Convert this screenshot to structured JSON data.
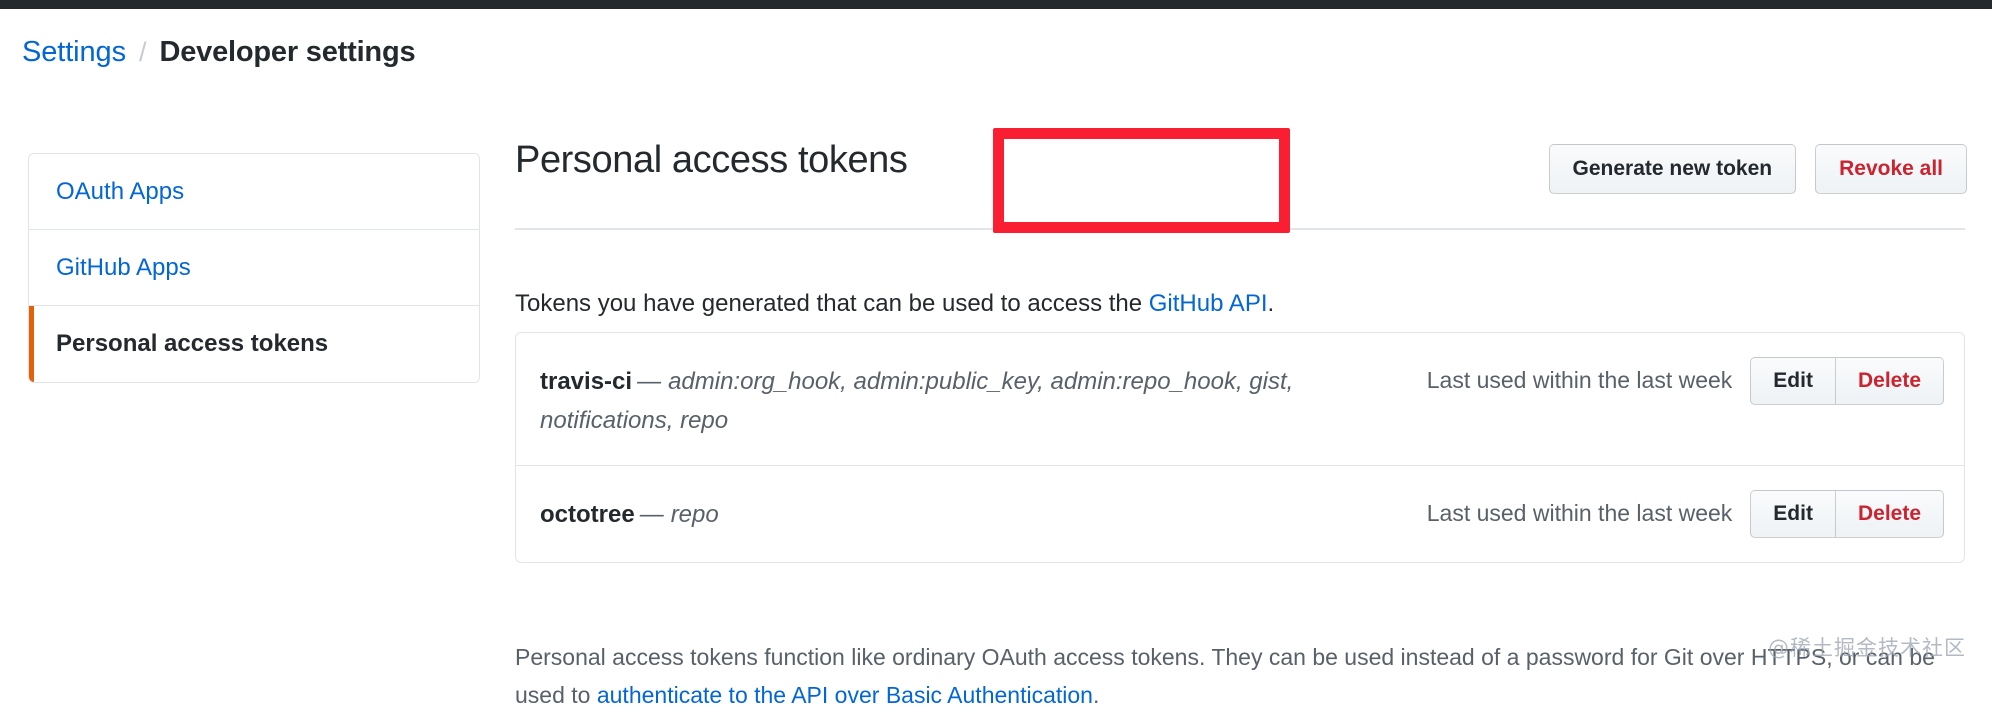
{
  "window": {
    "title": "Personal access tokens"
  },
  "topbar": {
    "color": "#24292e"
  },
  "breadcrumb": {
    "parent": "Settings",
    "separator": "/",
    "current": "Developer settings"
  },
  "sidebar": {
    "items": [
      {
        "label": "OAuth Apps",
        "active": false
      },
      {
        "label": "GitHub Apps",
        "active": false
      },
      {
        "label": "Personal access tokens",
        "active": true
      }
    ],
    "active_indicator_color": "#e36209"
  },
  "main": {
    "title": "Personal access tokens",
    "actions": {
      "generate_label": "Generate new token",
      "revoke_label": "Revoke all"
    },
    "intro": {
      "before_link": "Tokens you have generated that can be used to access the ",
      "link_text": "GitHub API",
      "after_link": "."
    },
    "tokens": [
      {
        "name": "travis-ci",
        "dash": "—",
        "scopes": "admin:org_hook, admin:public_key, admin:repo_hook, gist, notifications, repo",
        "last_used": "Last used within the last week",
        "edit_label": "Edit",
        "delete_label": "Delete"
      },
      {
        "name": "octotree",
        "dash": "—",
        "scopes": "repo",
        "last_used": "Last used within the last week",
        "edit_label": "Edit",
        "delete_label": "Delete"
      }
    ],
    "footer": {
      "line1": "Personal access tokens function like ordinary OAuth access tokens. They can be used instead of a password for Git over HTTPS,",
      "line2_before": "or can be used to ",
      "line2_link": "authenticate to the API over Basic Authentication",
      "line2_after": "."
    }
  },
  "annotation": {
    "target": "Generate new token",
    "color": "#fa1e32"
  },
  "watermark": {
    "text": "@稀土掘金技术社区"
  }
}
